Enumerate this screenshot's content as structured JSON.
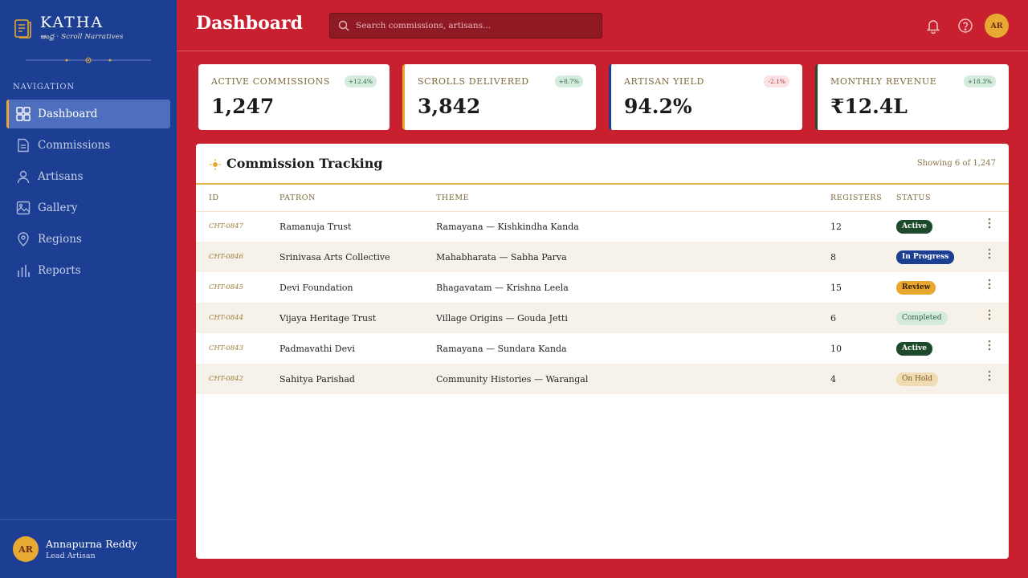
{
  "brand": {
    "name": "KATHA",
    "tagline": "ఆంధ్ర · Scroll Narratives"
  },
  "sidebar": {
    "heading": "NAVIGATION",
    "items": [
      {
        "label": "Dashboard",
        "icon": "grid-icon",
        "active": true
      },
      {
        "label": "Commissions",
        "icon": "document-icon"
      },
      {
        "label": "Artisans",
        "icon": "user-icon"
      },
      {
        "label": "Gallery",
        "icon": "image-icon"
      },
      {
        "label": "Regions",
        "icon": "map-pin-icon"
      },
      {
        "label": "Reports",
        "icon": "bar-chart-icon"
      }
    ],
    "user": {
      "initials": "AR",
      "name": "Annapurna Reddy",
      "role": "Lead Artisan"
    }
  },
  "header": {
    "title": "Dashboard",
    "search_placeholder": "Search commissions, artisans...",
    "avatar_initials": "AR"
  },
  "stats": [
    {
      "label": "Active Commissions",
      "value": "1,247",
      "change": "+12.4%",
      "trend": "up"
    },
    {
      "label": "Scrolls Delivered",
      "value": "3,842",
      "change": "+8.7%",
      "trend": "up"
    },
    {
      "label": "Artisan Yield",
      "value": "94.2%",
      "change": "-2.1%",
      "trend": "down"
    },
    {
      "label": "Monthly Revenue",
      "value": "₹12.4L",
      "change": "+18.3%",
      "trend": "up"
    }
  ],
  "table": {
    "title": "Commission Tracking",
    "count_text": "Showing 6 of 1,247",
    "columns": [
      "ID",
      "PATRON",
      "THEME",
      "REGISTERS",
      "STATUS"
    ],
    "rows": [
      {
        "id": "CHT-0847",
        "patron": "Ramanuja Trust",
        "theme": "Ramayana — Kishkindha Kanda",
        "registers": "12",
        "status": "Active"
      },
      {
        "id": "CHT-0846",
        "patron": "Srinivasa Arts Collective",
        "theme": "Mahabharata — Sabha Parva",
        "registers": "8",
        "status": "In Progress"
      },
      {
        "id": "CHT-0845",
        "patron": "Devi Foundation",
        "theme": "Bhagavatam — Krishna Leela",
        "registers": "15",
        "status": "Review"
      },
      {
        "id": "CHT-0844",
        "patron": "Vijaya Heritage Trust",
        "theme": "Village Origins — Gouda Jetti",
        "registers": "6",
        "status": "Completed"
      },
      {
        "id": "CHT-0843",
        "patron": "Padmavathi Devi",
        "theme": "Ramayana — Sundara Kanda",
        "registers": "10",
        "status": "Active"
      },
      {
        "id": "CHT-0842",
        "patron": "Sahitya Parishad",
        "theme": "Community Histories — Warangal",
        "registers": "4",
        "status": "On Hold"
      }
    ]
  },
  "colors": {
    "primary_red": "#c8202f",
    "sidebar_blue": "#1c3f94",
    "accent_gold": "#e8a830",
    "active_green": "#1d4a2b"
  }
}
